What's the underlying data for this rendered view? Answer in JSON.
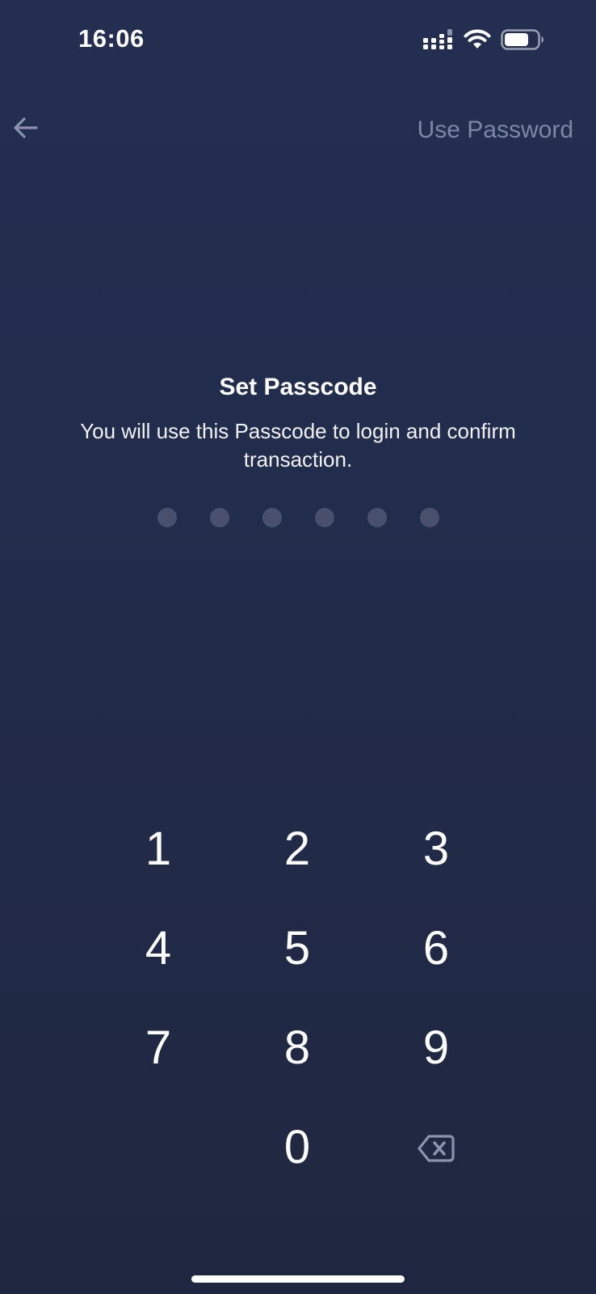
{
  "status_bar": {
    "time": "16:06",
    "icons": [
      "signal-icon",
      "wifi-icon",
      "battery-icon"
    ]
  },
  "nav": {
    "back_icon": "arrow-left-icon",
    "use_password_label": "Use Password"
  },
  "passcode": {
    "title": "Set Passcode",
    "subtitle": "You will use this Passcode to login and confirm transaction.",
    "length": 6,
    "entered": 0
  },
  "keypad": {
    "keys": [
      "1",
      "2",
      "3",
      "4",
      "5",
      "6",
      "7",
      "8",
      "9",
      "",
      "0",
      "backspace"
    ],
    "backspace_icon": "backspace-icon"
  },
  "colors": {
    "background": "#222b4a",
    "dot_empty": "#48506d",
    "muted_text": "#7e86a4",
    "icon_muted": "#8b92ad"
  }
}
